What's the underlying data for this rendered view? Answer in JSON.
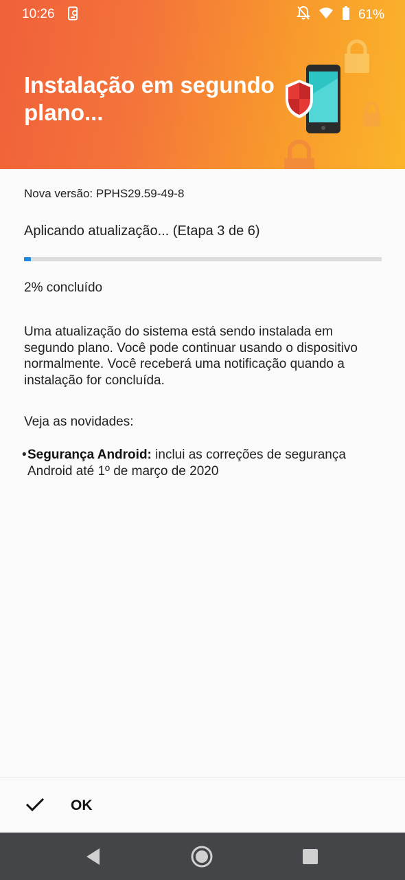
{
  "status_bar": {
    "time": "10:26",
    "battery_percent": "61%",
    "icons": [
      "screen-recorder-icon",
      "notifications-off-icon",
      "wifi-icon",
      "battery-icon"
    ]
  },
  "header": {
    "title": "Instalação em segundo plano...",
    "colors": {
      "gradient_start": "#f0603a",
      "gradient_end": "#fbb52a"
    }
  },
  "update": {
    "version_line": "Nova versão: PPHS29.59-49-8",
    "step_text": "Aplicando atualização... (Etapa 3 de 6)",
    "progress_fraction": 0.02,
    "percent_text": "2% concluído",
    "description": "Uma atualização do sistema está sendo instalada em segundo plano. Você pode continuar usando o dispositivo normalmente. Você receberá uma notificação quando a instalação for concluída.",
    "news_heading": "Veja as novidades:",
    "news_items": [
      {
        "bullet": "•",
        "title": "Segurança Android:",
        "text": " inclui as correções de segurança Android até 1º de março de 2020"
      }
    ]
  },
  "actions": {
    "ok_label": "OK"
  },
  "accent_color": "#1e88e5"
}
